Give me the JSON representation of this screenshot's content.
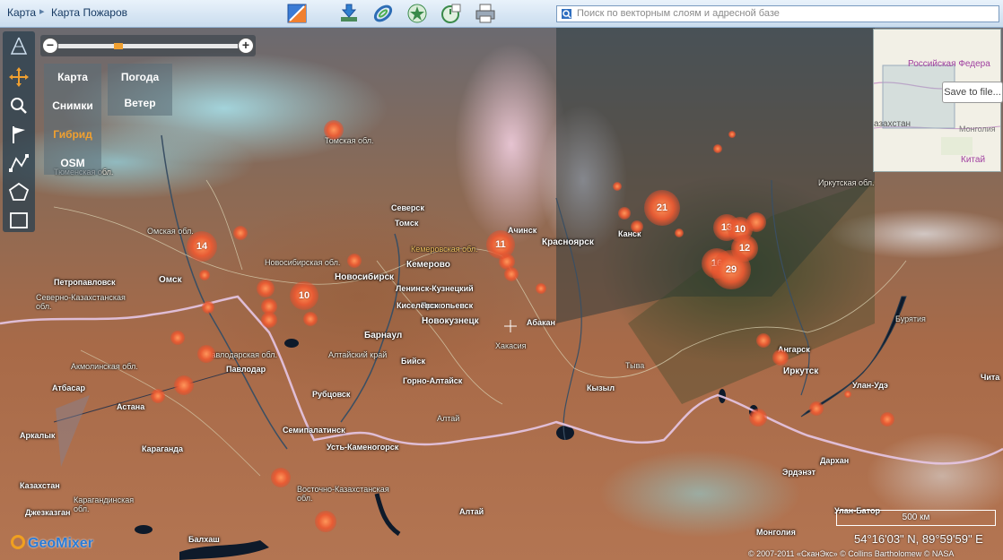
{
  "header": {
    "breadcrumb_root": "Карта",
    "breadcrumb_current": "Карта Пожаров",
    "search_placeholder": "Поиск по векторным слоям и адресной базе"
  },
  "map_types": [
    "Карта",
    "Снимки",
    "Гибрид",
    "OSM"
  ],
  "active_map_type": "Гибрид",
  "overlays": [
    "Погода",
    "Ветер"
  ],
  "minimap": {
    "labels": [
      "Российская Федера",
      "азахстан",
      "Монголия",
      "Китай"
    ],
    "save_button": "Save to file..."
  },
  "scale_label": "500 км",
  "coordinates": "54°16'03\" N, 89°59'59\" E",
  "copyright": "© 2007-2011 «СканЭкс» © Collins Bartholomew © NASA",
  "logo_text": "GeoMixer",
  "cities": [
    {
      "name": "Омск"
    },
    {
      "name": "Новосибирск"
    },
    {
      "name": "Кемерово"
    },
    {
      "name": "Томск"
    },
    {
      "name": "Северск"
    },
    {
      "name": "Ленинск-Кузнецкий"
    },
    {
      "name": "Прокопьевск"
    },
    {
      "name": "Киселевск"
    },
    {
      "name": "Новокузнецк"
    },
    {
      "name": "Барнаул"
    },
    {
      "name": "Бийск"
    },
    {
      "name": "Горно-Алтайск"
    },
    {
      "name": "Рубцовск"
    },
    {
      "name": "Семипалатинск"
    },
    {
      "name": "Усть-Каменогорск"
    },
    {
      "name": "Павлодар"
    },
    {
      "name": "Петропавловск"
    },
    {
      "name": "Астана"
    },
    {
      "name": "Атбасар"
    },
    {
      "name": "Аркалык"
    },
    {
      "name": "Караганда"
    },
    {
      "name": "Казахстан"
    },
    {
      "name": "Джезказган"
    },
    {
      "name": "Балхаш"
    },
    {
      "name": "Ачинск"
    },
    {
      "name": "Красноярск"
    },
    {
      "name": "Абакан"
    },
    {
      "name": "Канск"
    },
    {
      "name": "Кызыл"
    },
    {
      "name": "Иркутск"
    },
    {
      "name": "Ангарск"
    },
    {
      "name": "Улан-Удэ"
    },
    {
      "name": "Чита"
    },
    {
      "name": "Дархан"
    },
    {
      "name": "Эрдэнэт"
    },
    {
      "name": "Улан-Батор"
    },
    {
      "name": "Монголия"
    },
    {
      "name": "Алтай"
    }
  ],
  "regions": [
    "Томская обл.",
    "Тюменская обл.",
    "Омская обл.",
    "Новосибирская обл.",
    "Кемеровская обл.",
    "Алтайский край",
    "Хакасия",
    "Тыва",
    "Иркутская обл.",
    "Бурятия",
    "Павлодарская обл.",
    "Акмолинская обл.",
    "Северно-Казахстанская обл.",
    "Карагандинская обл.",
    "Восточно-Казахстанская обл.",
    "Алтай"
  ],
  "fire_clusters": [
    {
      "count": "14"
    },
    {
      "count": "10"
    },
    {
      "count": "11"
    },
    {
      "count": "21"
    },
    {
      "count": "13"
    },
    {
      "count": "10"
    },
    {
      "count": "12"
    },
    {
      "count": "16"
    },
    {
      "count": "29"
    }
  ]
}
